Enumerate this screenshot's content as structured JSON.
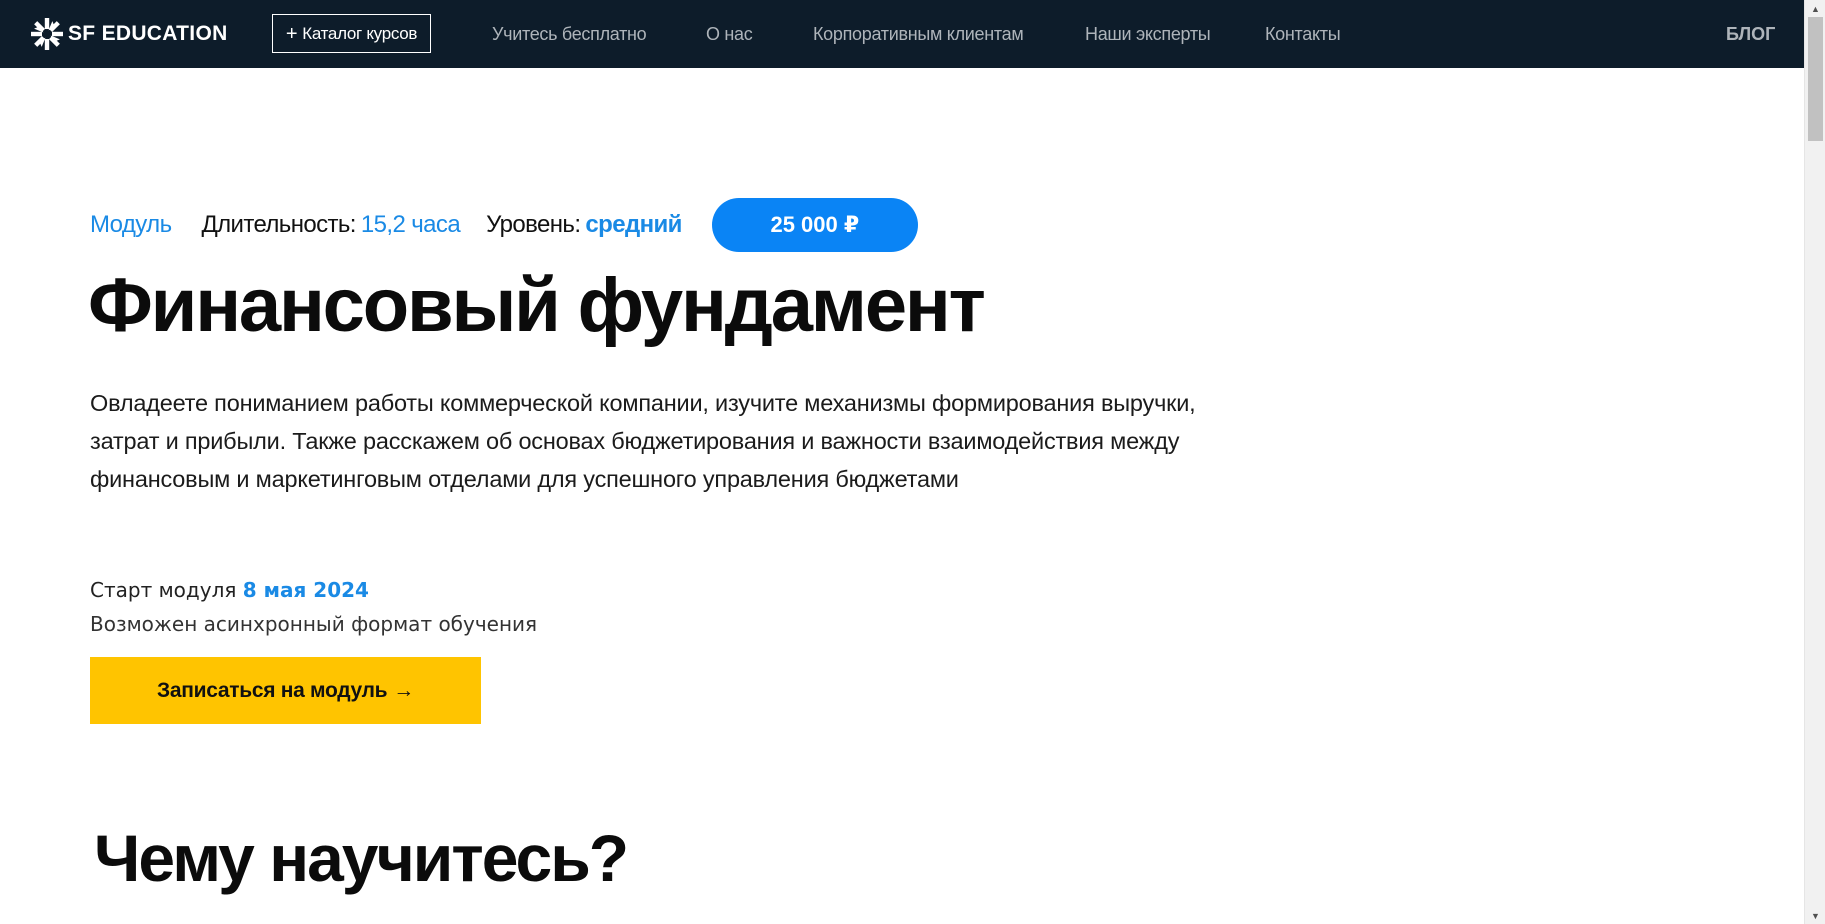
{
  "nav": {
    "logo_text": "SF EDUCATION",
    "catalog_label": "Каталог курсов",
    "links": [
      {
        "label": "Учитесь бесплатно"
      },
      {
        "label": "О нас"
      },
      {
        "label": "Корпоративным клиентам"
      },
      {
        "label": "Наши эксперты"
      },
      {
        "label": "Контакты"
      }
    ],
    "blog_label": "БЛОГ"
  },
  "hero": {
    "type_label": "Модуль",
    "duration_label": "Длительность:",
    "duration_value": "15,2 часа",
    "level_label": "Уровень:",
    "level_value": "средний",
    "price": "25 000 ₽",
    "title": "Финансовый фундамент",
    "description_lines": [
      "Овладеете пониманием работы коммерческой компании, изучите механизмы формирования выручки,",
      "затрат и прибыли. Также расскажем об основах бюджетирования и важности взаимодействия между",
      "финансовым и маркетинговым отделами для успешного управления бюджетами"
    ],
    "start_label": "Старт модуля",
    "start_date": "8 мая 2024",
    "async_note": "Возможен асинхронный формат обучения",
    "enroll_label": "Записаться на модуль",
    "enroll_arrow": "→"
  },
  "section": {
    "title": "Чему научитесь?"
  },
  "colors": {
    "nav_bg": "#0d1c2a",
    "accent_blue": "#1a8ae5",
    "price_blue": "#0a84f5",
    "cta_yellow": "#ffc400"
  },
  "icons": {
    "logo": "sf-snowflake-logo-icon",
    "catalog": "plus-icon",
    "scroll_up": "triangle-up-icon",
    "scroll_down": "triangle-down-icon"
  }
}
